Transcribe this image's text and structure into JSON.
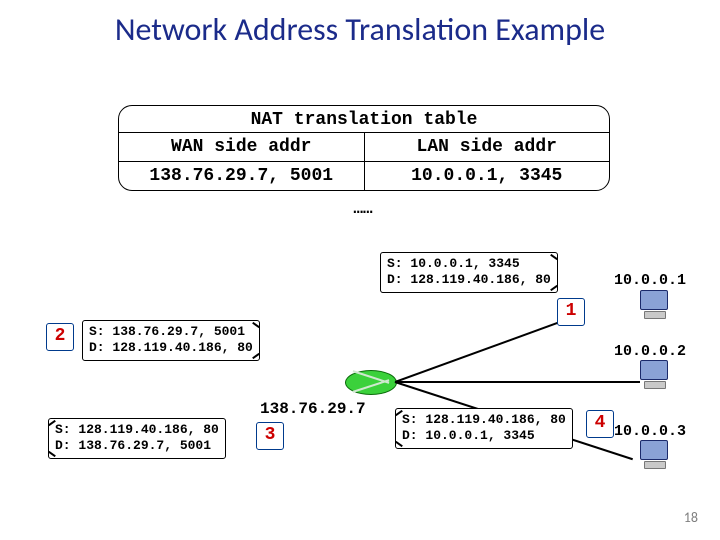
{
  "title": "Network Address Translation Example",
  "slide_number": "18",
  "nat_table": {
    "caption": "NAT translation table",
    "headers": {
      "wan": "WAN side addr",
      "lan": "LAN side addr"
    },
    "row": {
      "wan": "138.76.29.7, 5001",
      "lan": "10.0.0.1, 3345"
    },
    "ellipsis": "……"
  },
  "router_ip": "138.76.29.7",
  "hosts": {
    "h1": "10.0.0.1",
    "h2": "10.0.0.2",
    "h3": "10.0.0.3"
  },
  "packets": {
    "p1": {
      "src": "S: 10.0.0.1, 3345",
      "dst": "D: 128.119.40.186, 80"
    },
    "p2": {
      "src": "S: 138.76.29.7, 5001",
      "dst": "D: 128.119.40.186, 80"
    },
    "p3": {
      "src": "S: 128.119.40.186, 80",
      "dst": "D: 138.76.29.7, 5001"
    },
    "p4": {
      "src": "S: 128.119.40.186, 80",
      "dst": "D: 10.0.0.1, 3345"
    }
  },
  "steps": {
    "s1": "1",
    "s2": "2",
    "s3": "3",
    "s4": "4"
  },
  "chart_data": {
    "type": "table",
    "title": "NAT translation table",
    "columns": [
      "WAN side addr",
      "LAN side addr"
    ],
    "rows": [
      [
        "138.76.29.7, 5001",
        "10.0.0.1, 3345"
      ]
    ],
    "packet_flow": [
      {
        "step": 1,
        "src": "10.0.0.1:3345",
        "dst": "128.119.40.186:80"
      },
      {
        "step": 2,
        "src": "138.76.29.7:5001",
        "dst": "128.119.40.186:80"
      },
      {
        "step": 3,
        "src": "128.119.40.186:80",
        "dst": "138.76.29.7:5001"
      },
      {
        "step": 4,
        "src": "128.119.40.186:80",
        "dst": "10.0.0.1:3345"
      }
    ],
    "lan_hosts": [
      "10.0.0.1",
      "10.0.0.2",
      "10.0.0.3"
    ],
    "router_wan_ip": "138.76.29.7"
  }
}
